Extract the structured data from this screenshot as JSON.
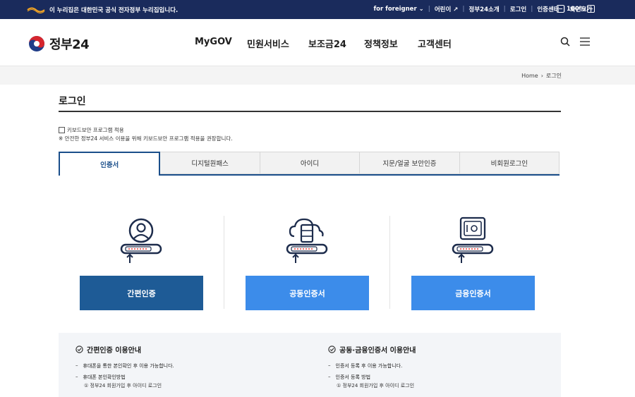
{
  "topbar": {
    "notice": "이 누리집은 대한민국 공식 전자정부 누리집입니다.",
    "links": [
      "for foreigner",
      "어린이",
      "정부24소개",
      "로그인",
      "인증센터"
    ],
    "zoom_label": "화면크기",
    "zoom_value": "100%",
    "zoom_minus": "−",
    "zoom_plus": "+"
  },
  "header": {
    "logo": "정부24",
    "nav": [
      "MyGOV",
      "민원서비스",
      "보조금24",
      "정책정보",
      "고객센터"
    ]
  },
  "breadcrumb": {
    "home": "Home",
    "current": "로그인"
  },
  "page_title": "로그인",
  "keyboard": {
    "checkbox_label": "키보드보안 프로그램 적용",
    "note": "※ 안전한 정부24 서비스 이용을 위해 키보드보안 프로그램 적용을 권장합니다."
  },
  "tabs": [
    "인증서",
    "디지털원패스",
    "아이디",
    "지문/얼굴 보안인증",
    "비회원로그인"
  ],
  "methods": [
    {
      "label": "간편인증",
      "color": "#1e5b96"
    },
    {
      "label": "공동인증서",
      "color": "#3c8cea"
    },
    {
      "label": "금융인증서",
      "color": "#3c8cea"
    }
  ],
  "guide": {
    "left": {
      "title": "간편인증 이용안내",
      "item1": "휴대폰을 통한 본인확인 후 이용 가능합니다.",
      "item2": "휴대폰 본인확인방법",
      "sub": "① 정부24 회원가입 후 아이디 로그인"
    },
    "right": {
      "title": "공동·금융인증서 이용안내",
      "item1": "인증서 등록 후 이용 가능합니다.",
      "item2": "인증서 등록 방법",
      "sub": "① 정부24 회원가입 후 아이디 로그인"
    }
  },
  "colors": {
    "navy": "#1a2b5c",
    "accent": "#1a4e8a",
    "btn_dark": "#1e5b96",
    "btn_light": "#3c8cea"
  }
}
